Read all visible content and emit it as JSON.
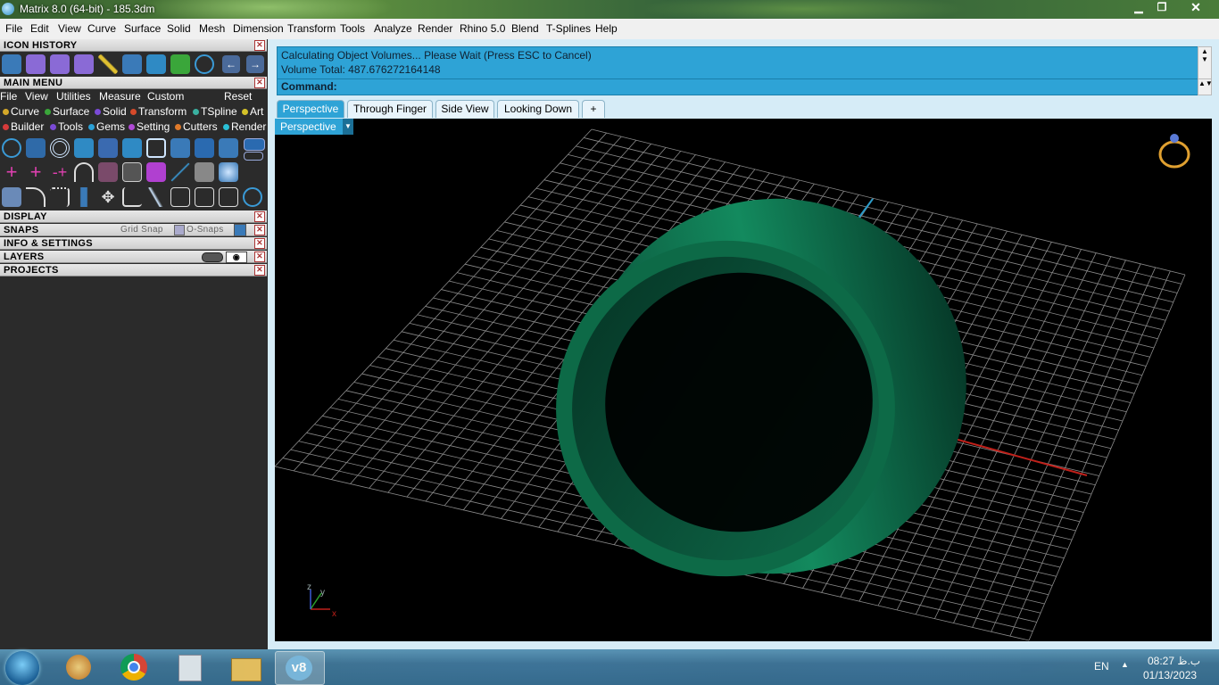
{
  "window": {
    "title": "Matrix 8.0 (64-bit) - 185.3dm",
    "controls": {
      "minimize": "▁",
      "maximize": "❐",
      "close": "✕"
    }
  },
  "menubar": [
    "File",
    "Edit",
    "View",
    "Curve",
    "Surface",
    "Solid",
    "Mesh",
    "Dimension",
    "Transform",
    "Tools",
    "Analyze",
    "Render",
    "Rhino 5.0",
    "Blend",
    "T-Splines",
    "Help"
  ],
  "panels": {
    "icon_history": "ICON HISTORY",
    "main_menu": "MAIN MENU",
    "display": "DISPLAY",
    "snaps": "SNAPS",
    "info_settings": "INFO & SETTINGS",
    "layers": "LAYERS",
    "projects": "PROJECTS"
  },
  "main_menu_bar": {
    "items": [
      "File",
      "View",
      "Utilities",
      "Measure",
      "Custom"
    ],
    "reset": "Reset"
  },
  "main_menu_tabs_row1": [
    {
      "label": "Curve",
      "color": "#d4a829"
    },
    {
      "label": "Surface",
      "color": "#3aa63a"
    },
    {
      "label": "Solid",
      "color": "#7a4ad6"
    },
    {
      "label": "Transform",
      "color": "#d64a2a"
    },
    {
      "label": "TSpline",
      "color": "#3ab0a0"
    },
    {
      "label": "Art",
      "color": "#d4c229"
    }
  ],
  "main_menu_tabs_row2": [
    {
      "label": "Builder",
      "color": "#d63a3a"
    },
    {
      "label": "Tools",
      "color": "#7a4ad6"
    },
    {
      "label": "Gems",
      "color": "#2aa0d6"
    },
    {
      "label": "Setting",
      "color": "#b04ad6"
    },
    {
      "label": "Cutters",
      "color": "#e07a2a"
    },
    {
      "label": "Render",
      "color": "#2ac0d6"
    }
  ],
  "snaps": {
    "grid_snap": "Grid Snap",
    "osnaps": "O-Snaps"
  },
  "command": {
    "line1": "Calculating Object Volumes... Please Wait (Press ESC to Cancel)",
    "line2": "Volume Total: 487.676272164148",
    "prompt": "Command:"
  },
  "view_tabs": [
    "Perspective",
    "Through Finger",
    "Side View",
    "Looking Down"
  ],
  "view_tab_add": "+",
  "viewport": {
    "label": "Perspective",
    "axes": {
      "z": "z",
      "y": "y",
      "x": "x"
    },
    "ring_color": "#0f6b4a"
  },
  "taskbar": {
    "language": "EN",
    "time": "08:27 ب.ظ",
    "date": "01/13/2023",
    "active_app": "v8"
  }
}
